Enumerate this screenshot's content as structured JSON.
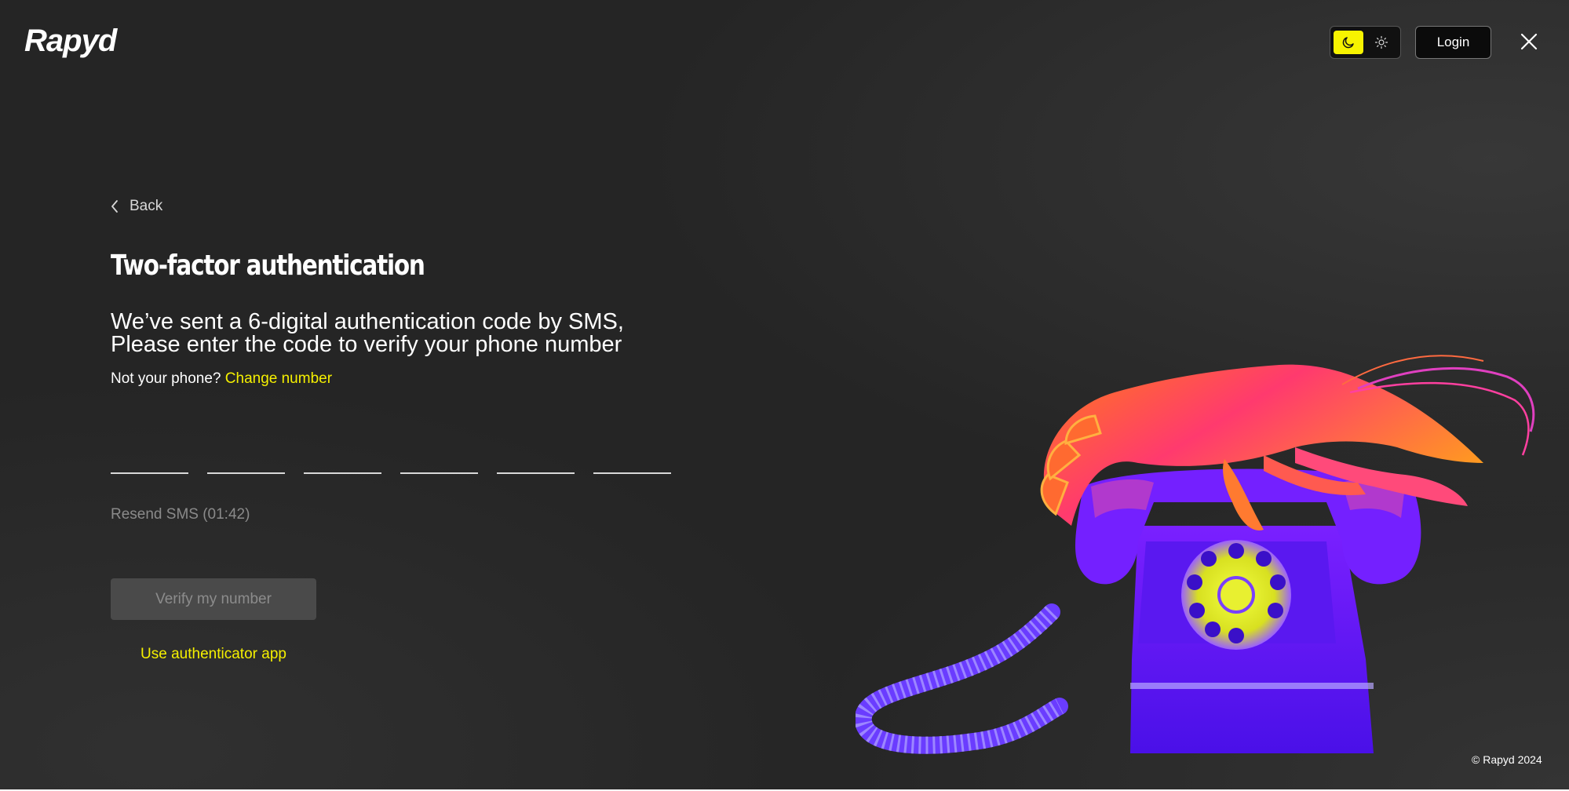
{
  "header": {
    "logo_text": "Rapyd",
    "theme_toggle": {
      "options": [
        {
          "name": "dark",
          "icon": "moon-icon",
          "active": true
        },
        {
          "name": "light",
          "icon": "sun-icon",
          "active": false
        }
      ],
      "accent_color": "#f7f300"
    },
    "login_label": "Login",
    "close_icon": "close-icon"
  },
  "main": {
    "back_label": "Back",
    "title": "Two-factor authentication",
    "lead_line1": "We’ve sent a 6-digital authentication code by SMS,",
    "lead_line2": "Please enter the code to verify your phone number",
    "not_your_phone": "Not your phone?",
    "change_number": "Change number",
    "code_inputs": [
      "",
      "",
      "",
      "",
      "",
      ""
    ],
    "resend_sms": "Resend SMS (01:42)",
    "verify_button": "Verify my number",
    "verify_enabled": false,
    "use_authenticator_app": "Use authenticator app"
  },
  "illustration": {
    "subject": "lobster-telephone-illustration"
  },
  "footer": {
    "copyright": "© Rapyd 2024"
  },
  "colors": {
    "background": "#252525",
    "accent_yellow": "#f5f000",
    "disabled_button_bg": "#4a4a4a",
    "disabled_text": "#8a8a8a"
  }
}
